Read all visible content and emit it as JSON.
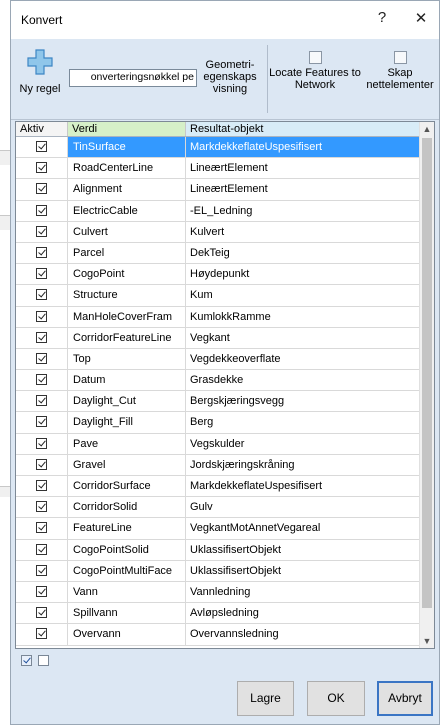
{
  "window": {
    "title": "Konvert",
    "help_glyph": "?",
    "close_glyph": "✕"
  },
  "toolbar": {
    "new_rule_label": "Ny regel",
    "conversion_key_value": "onverteringsnøkkel pe",
    "geometry_view_label": "Geometri-egenskaps visning",
    "locate_features_label": "Locate Features to Network",
    "create_elements_label": "Skap nettelementer"
  },
  "grid": {
    "columns": [
      "Aktiv",
      "Verdi",
      "Resultat-objekt"
    ],
    "rows": [
      {
        "aktiv": true,
        "verdi": "TinSurface",
        "resultat": "MarkdekkeflateUspesifisert",
        "selected": true
      },
      {
        "aktiv": true,
        "verdi": "RoadCenterLine",
        "resultat": "LineærtElement"
      },
      {
        "aktiv": true,
        "verdi": "Alignment",
        "resultat": "LineærtElement"
      },
      {
        "aktiv": true,
        "verdi": "ElectricCable",
        "resultat": "-EL_Ledning"
      },
      {
        "aktiv": true,
        "verdi": "Culvert",
        "resultat": "Kulvert"
      },
      {
        "aktiv": true,
        "verdi": "Parcel",
        "resultat": "DekTeig"
      },
      {
        "aktiv": true,
        "verdi": "CogoPoint",
        "resultat": "Høydepunkt"
      },
      {
        "aktiv": true,
        "verdi": "Structure",
        "resultat": "Kum"
      },
      {
        "aktiv": true,
        "verdi": "ManHoleCoverFram",
        "resultat": "KumlokkRamme"
      },
      {
        "aktiv": true,
        "verdi": "CorridorFeatureLine",
        "resultat": "Vegkant"
      },
      {
        "aktiv": true,
        "verdi": "Top",
        "resultat": "Vegdekkeoverflate"
      },
      {
        "aktiv": true,
        "verdi": "Datum",
        "resultat": "Grasdekke"
      },
      {
        "aktiv": true,
        "verdi": "Daylight_Cut",
        "resultat": "Bergskjæringsvegg"
      },
      {
        "aktiv": true,
        "verdi": "Daylight_Fill",
        "resultat": "Berg"
      },
      {
        "aktiv": true,
        "verdi": "Pave",
        "resultat": "Vegskulder"
      },
      {
        "aktiv": true,
        "verdi": "Gravel",
        "resultat": "Jordskjæringskråning"
      },
      {
        "aktiv": true,
        "verdi": "CorridorSurface",
        "resultat": "MarkdekkeflateUspesifisert"
      },
      {
        "aktiv": true,
        "verdi": "CorridorSolid",
        "resultat": "Gulv"
      },
      {
        "aktiv": true,
        "verdi": "FeatureLine",
        "resultat": "VegkantMotAnnetVegareal"
      },
      {
        "aktiv": true,
        "verdi": "CogoPointSolid",
        "resultat": "UklassifisertObjekt"
      },
      {
        "aktiv": true,
        "verdi": "CogoPointMultiFace",
        "resultat": "UklassifisertObjekt"
      },
      {
        "aktiv": true,
        "verdi": "Vann",
        "resultat": "Vannledning"
      },
      {
        "aktiv": true,
        "verdi": "Spillvann",
        "resultat": "Avløpsledning"
      },
      {
        "aktiv": true,
        "verdi": "Overvann",
        "resultat": "Overvannsledning"
      }
    ]
  },
  "footer": {
    "save_label": "Lagre",
    "ok_label": "OK",
    "cancel_label": "Avbryt"
  },
  "colors": {
    "selection": "#3399ff",
    "verdi_header": "#d6f0c8",
    "result_header": "#d8ecf7",
    "toolbar_bg": "#dce7f3"
  }
}
